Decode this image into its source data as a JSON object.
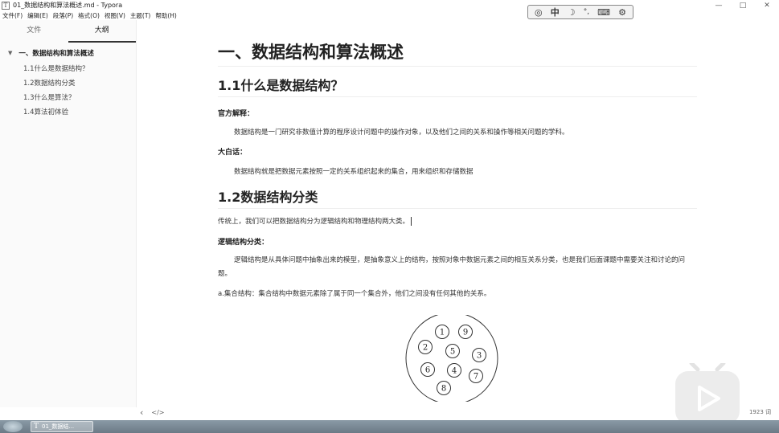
{
  "window": {
    "app_icon": "T",
    "title": "01_数据结构和算法概述.md - Typora",
    "minimize": "—",
    "maximize": "□",
    "close": "✕"
  },
  "menu": [
    "文件(F)",
    "编辑(E)",
    "段落(P)",
    "格式(O)",
    "视图(V)",
    "主题(T)",
    "帮助(H)"
  ],
  "ime_toolbar": {
    "logo": "◎",
    "lang": "中",
    "moon": "☽",
    "punct": "°,",
    "keyboard": "⌨",
    "settings": "⚙"
  },
  "sidebar": {
    "tabs": [
      {
        "label": "文件",
        "active": false
      },
      {
        "label": "大纲",
        "active": true
      }
    ],
    "outline": {
      "h1": "一、数据结构和算法概述",
      "children": [
        "1.1什么是数据结构？",
        "1.2数据结构分类",
        "1.3什么是算法？",
        "1.4算法初体验"
      ]
    }
  },
  "doc": {
    "h1": "一、数据结构和算法概述",
    "s1_title": "1.1什么是数据结构？",
    "official_label": "官方解释：",
    "official_text": "数据结构是一门研究非数值计算的程序设计问题中的操作对象，以及他们之间的关系和操作等相关问题的学科。",
    "plain_label": "大白话：",
    "plain_text": "数据结构就是把数据元素按照一定的关系组织起来的集合，用来组织和存储数据",
    "s2_title": "1.2数据结构分类",
    "s2_intro": "传统上，我们可以把数据结构分为逻辑结构和物理结构两大类。",
    "logic_label": "逻辑结构分类：",
    "logic_text": "逻辑结构是从具体问题中抽象出来的模型，是抽象意义上的结构，按照对象中数据元素之间的相互关系分类，也是我们后面课题中需要关注和讨论的问题。",
    "set_text": "a.集合结构：集合结构中数据元素除了属于同一个集合外，他们之间没有任何其他的关系。",
    "set_elements": [
      "1",
      "9",
      "2",
      "5",
      "3",
      "6",
      "4",
      "7",
      "8"
    ]
  },
  "status": {
    "back": "‹",
    "source": "</>",
    "word_count": "1923 词"
  },
  "taskbar": {
    "item_icon": "T",
    "item_label": "01_数据结..."
  },
  "colors": {
    "accent": "#333333",
    "taskbar": "#7a8a96",
    "badge": "#e9e9e9"
  }
}
